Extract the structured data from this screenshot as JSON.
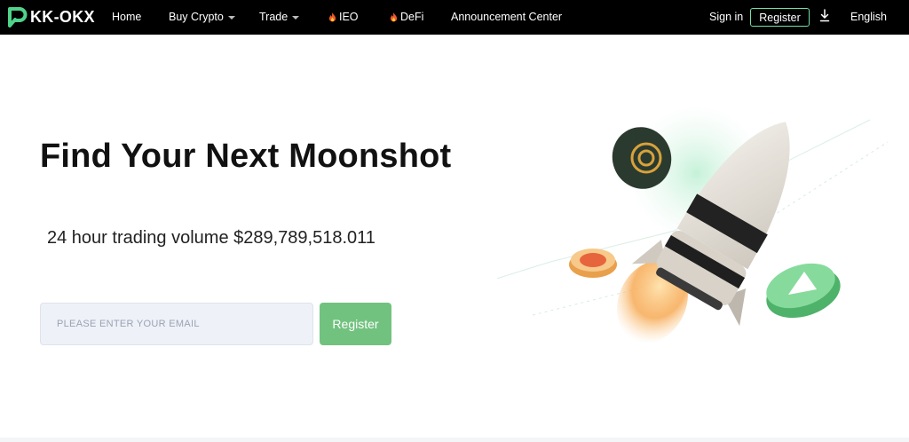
{
  "nav": {
    "brand": "KK-OKX",
    "items": {
      "home": "Home",
      "buy_crypto": "Buy Crypto",
      "trade": "Trade",
      "ieo": "IEO",
      "defi": "DeFi",
      "announcements": "Announcement Center"
    },
    "sign_in": "Sign in",
    "register": "Register",
    "language": "English"
  },
  "hero": {
    "title": "Find Your Next Moonshot",
    "volume_text": "24 hour trading volume $289,789,518.011",
    "email_placeholder": "PLEASE ENTER YOUR EMAIL",
    "email_value": "",
    "register_button": "Register"
  },
  "colors": {
    "nav_bg": "#000000",
    "accent_green": "#72c27f",
    "register_outline": "#6fe0a8"
  },
  "icons": {
    "logo": "brand-p-icon",
    "fire": "fire-icon",
    "caret": "chevron-down-icon",
    "download": "download-icon"
  }
}
